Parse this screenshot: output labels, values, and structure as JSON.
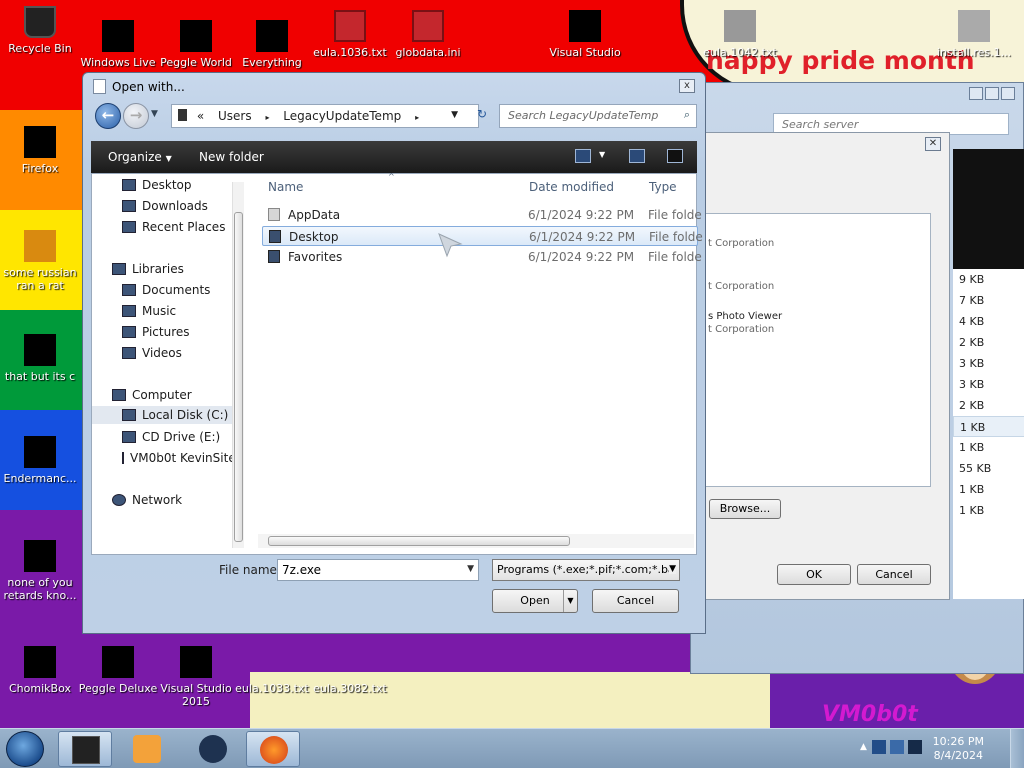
{
  "desktop": {
    "colors": {
      "red": "#f00000",
      "orange": "#ff8a00",
      "yellow": "#ffe600",
      "green": "#009a3a",
      "blue": "#1550e0",
      "purple": "#7a1aa8"
    },
    "banner_text": "happy pride month",
    "watermark": "VM0b0t",
    "icons": [
      {
        "label": "Recycle Bin"
      },
      {
        "label": "Windows Live"
      },
      {
        "label": "Peggle World"
      },
      {
        "label": "Everything"
      },
      {
        "label": "eula.1036.txt"
      },
      {
        "label": "globdata.ini"
      },
      {
        "label": "Visual Studio"
      },
      {
        "label": "eula.1042.txt"
      },
      {
        "label": "install.res.1..."
      },
      {
        "label": "Firefox"
      },
      {
        "label": "some russian ran a rat"
      },
      {
        "label": "that but its c"
      },
      {
        "label": "Endermanc..."
      },
      {
        "label": "none of you retards kno..."
      },
      {
        "label": "ChomikBox"
      },
      {
        "label": "Peggle Deluxe"
      },
      {
        "label": "Visual Studio 2015"
      },
      {
        "label": "eula.1033.txt"
      },
      {
        "label": "eula.3082.txt"
      }
    ]
  },
  "back_window": {
    "search_placeholder": "Search server",
    "sizes": [
      "9 KB",
      "7 KB",
      "4 KB",
      "2 KB",
      "3 KB",
      "3 KB",
      "2 KB",
      "1 KB",
      "1 KB",
      "55 KB",
      "1 KB",
      "1 KB"
    ],
    "prop_lines": [
      "t Corporation",
      "t Corporation",
      "s Photo Viewer",
      "t Corporation"
    ],
    "browse_label": "Browse...",
    "ok_label": "OK",
    "cancel_label": "Cancel"
  },
  "dialog": {
    "title": "Open with...",
    "close_label": "x",
    "address": {
      "prefix": "«",
      "segments": [
        "Users",
        "LegacyUpdateTemp"
      ]
    },
    "search_placeholder": "Search LegacyUpdateTemp",
    "toolbar": {
      "organize": "Organize",
      "new_folder": "New folder"
    },
    "nav": {
      "favorites": [
        "Desktop",
        "Downloads",
        "Recent Places"
      ],
      "libraries_label": "Libraries",
      "libraries": [
        "Documents",
        "Music",
        "Pictures",
        "Videos"
      ],
      "computer_label": "Computer",
      "drives": [
        "Local Disk (C:)",
        "CD Drive (E:)",
        "VM0b0t KevinSite"
      ],
      "network_label": "Network"
    },
    "columns": {
      "name": "Name",
      "date": "Date modified",
      "type": "Type"
    },
    "files": [
      {
        "name": "AppData",
        "date": "6/1/2024 9:22 PM",
        "type": "File folde"
      },
      {
        "name": "Desktop",
        "date": "6/1/2024 9:22 PM",
        "type": "File folde"
      },
      {
        "name": "Favorites",
        "date": "6/1/2024 9:22 PM",
        "type": "File folde"
      }
    ],
    "file_name_label": "File name:",
    "file_name_value": "7z.exe",
    "file_type_value": "Programs (*.exe;*.pif;*.com;*.ba",
    "open_label": "Open",
    "cancel_label": "Cancel"
  },
  "taskbar": {
    "time": "10:26 PM",
    "date": "8/4/2024"
  }
}
